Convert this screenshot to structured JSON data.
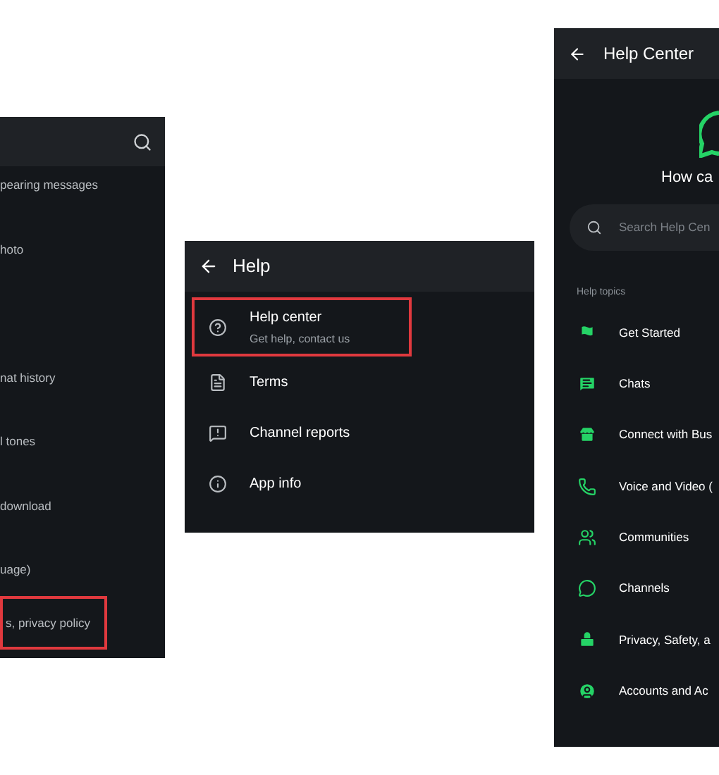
{
  "settings_panel": {
    "items": [
      {
        "text": "pearing messages",
        "highlighted": false
      },
      {
        "text": "hoto",
        "highlighted": false
      },
      {
        "text": "nat history",
        "highlighted": false
      },
      {
        "text": "l tones",
        "highlighted": false
      },
      {
        "text": "download",
        "highlighted": false
      },
      {
        "text": "uage)",
        "highlighted": false
      },
      {
        "text": "s, privacy policy",
        "highlighted": true
      }
    ]
  },
  "help_panel": {
    "title": "Help",
    "items": [
      {
        "kind": "question",
        "title": "Help center",
        "subtitle": "Get help, contact us",
        "highlighted": true
      },
      {
        "kind": "document",
        "title": "Terms",
        "highlighted": false
      },
      {
        "kind": "report",
        "title": "Channel reports",
        "highlighted": false
      },
      {
        "kind": "info",
        "title": "App info",
        "highlighted": false
      }
    ]
  },
  "help_center_panel": {
    "title": "Help Center",
    "heading": "How ca",
    "search": {
      "placeholder": "Search Help Cen"
    },
    "section": "Help topics",
    "topics": [
      {
        "kind": "flag",
        "label": "Get Started"
      },
      {
        "kind": "chat",
        "label": "Chats"
      },
      {
        "kind": "store",
        "label": "Connect with Bus"
      },
      {
        "kind": "phone",
        "label": "Voice and Video ("
      },
      {
        "kind": "people",
        "label": "Communities"
      },
      {
        "kind": "channel",
        "label": "Channels"
      },
      {
        "kind": "lock",
        "label": "Privacy, Safety, a"
      },
      {
        "kind": "account",
        "label": "Accounts and Ac"
      }
    ]
  }
}
